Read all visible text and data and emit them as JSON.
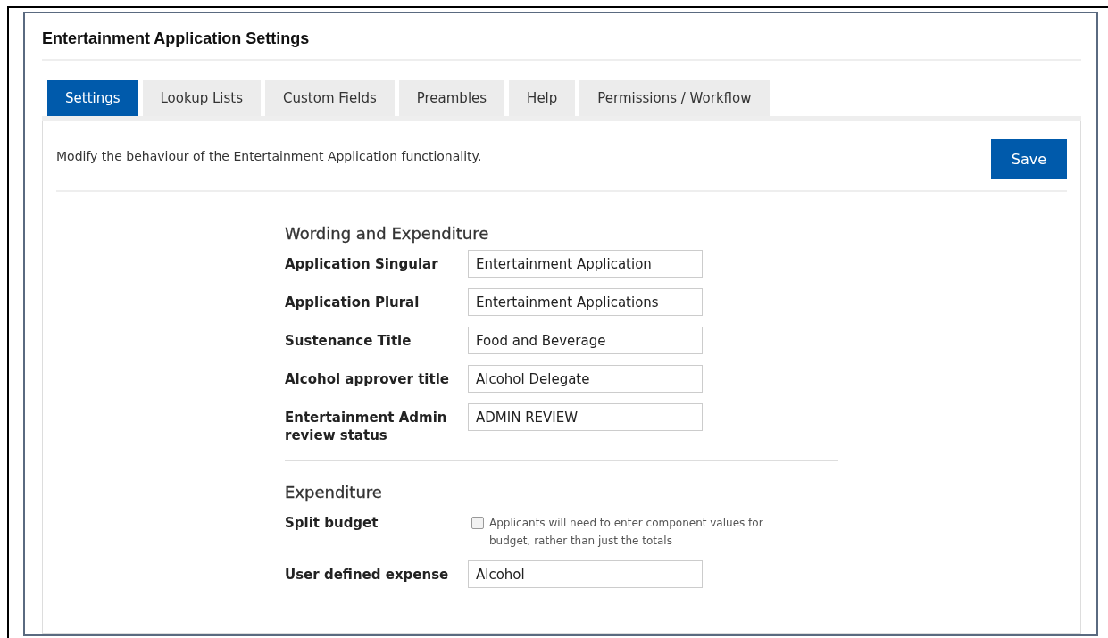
{
  "page": {
    "title": "Entertainment Application Settings"
  },
  "tabs": [
    {
      "label": "Settings",
      "selected": true
    },
    {
      "label": "Lookup Lists",
      "selected": false
    },
    {
      "label": "Custom Fields",
      "selected": false
    },
    {
      "label": "Preambles",
      "selected": false
    },
    {
      "label": "Help",
      "selected": false
    },
    {
      "label": "Permissions / Workflow",
      "selected": false
    }
  ],
  "description": "Modify the behaviour of the Entertainment Application functionality.",
  "save_button": "Save",
  "sections": [
    {
      "heading": "Wording and Expenditure",
      "fields": [
        {
          "kind": "text",
          "label": "Application Singular",
          "value": "Entertainment Application"
        },
        {
          "kind": "text",
          "label": "Application Plural",
          "value": "Entertainment Applications"
        },
        {
          "kind": "text",
          "label": "Sustenance Title",
          "value": "Food and Beverage"
        },
        {
          "kind": "text",
          "label": "Alcohol approver title",
          "value": "Alcohol Delegate"
        },
        {
          "kind": "text",
          "label": "Entertainment Admin review status",
          "value": "ADMIN REVIEW"
        }
      ]
    },
    {
      "heading": "Expenditure",
      "fields": [
        {
          "kind": "checkbox",
          "label": "Split budget",
          "text": "Applicants will need to enter component values for budget, rather than just the totals",
          "checked": false
        },
        {
          "kind": "text",
          "label": "User defined expense",
          "value": "Alcohol"
        }
      ]
    }
  ]
}
